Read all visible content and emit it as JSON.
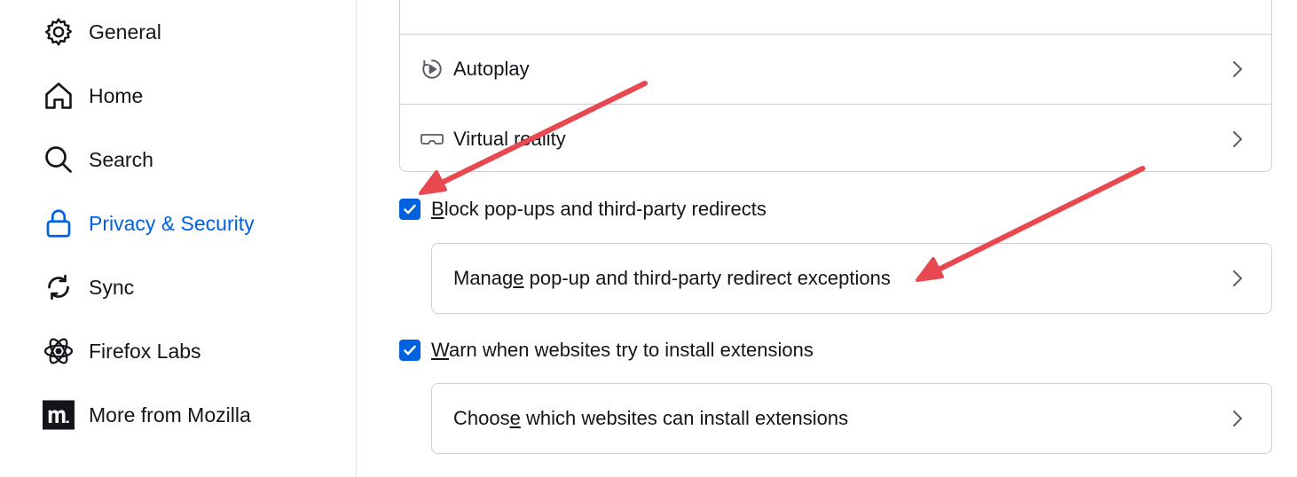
{
  "sidebar": {
    "items": [
      {
        "label": "General",
        "icon": "gear-icon"
      },
      {
        "label": "Home",
        "icon": "home-icon"
      },
      {
        "label": "Search",
        "icon": "search-icon"
      },
      {
        "label": "Privacy & Security",
        "icon": "lock-icon",
        "active": true
      },
      {
        "label": "Sync",
        "icon": "sync-icon"
      },
      {
        "label": "Firefox Labs",
        "icon": "atom-icon"
      },
      {
        "label": "More from Mozilla",
        "icon": "mozilla-icon"
      }
    ]
  },
  "permissions": {
    "rows": [
      {
        "label": "Autoplay",
        "icon": "autoplay-icon"
      },
      {
        "label": "Virtual reality",
        "icon": "vr-headset-icon"
      }
    ]
  },
  "popups": {
    "checkbox_access_key": "B",
    "checkbox_label_rest": "lock pop-ups and third-party redirects",
    "checked": true,
    "exceptions_prefix": "Manag",
    "exceptions_access_key": "e",
    "exceptions_rest": " pop-up and third-party redirect exceptions"
  },
  "addons": {
    "checkbox_access_key": "W",
    "checkbox_label_rest": "arn when websites try to install extensions",
    "checked": true,
    "exceptions_prefix": "Choos",
    "exceptions_access_key": "e",
    "exceptions_rest": " which websites can install extensions"
  },
  "colors": {
    "accent": "#0061e0",
    "annotation_arrow": "#e8484f",
    "border": "#cfcfd8"
  }
}
